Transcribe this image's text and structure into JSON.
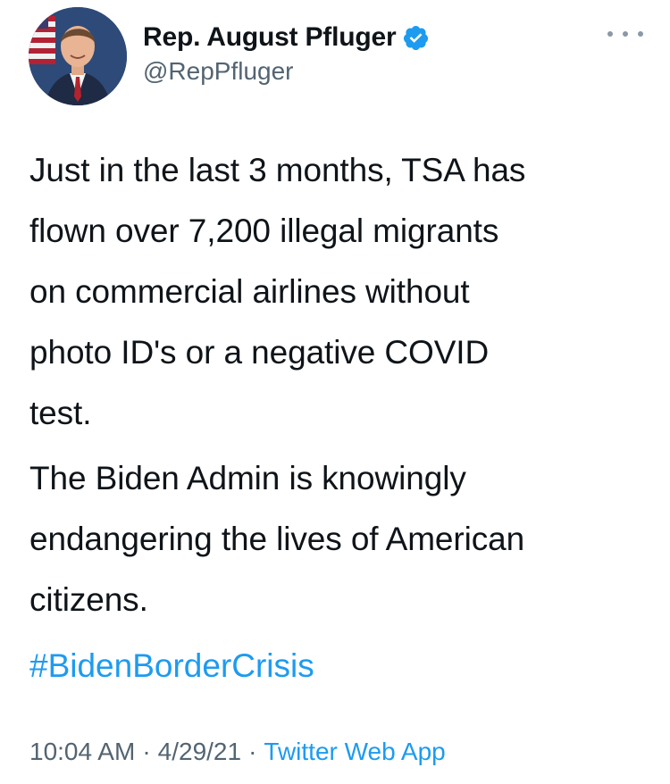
{
  "author": {
    "display_name": "Rep. August Pfluger",
    "handle": "@RepPfluger",
    "verified_icon": "verified-badge-icon",
    "avatar_icon": "profile-photo"
  },
  "tweet": {
    "paragraphs": [
      "Just in the last 3 months, TSA has\nflown over 7,200 illegal migrants\non commercial airlines without\nphoto ID's or a negative COVID\ntest.",
      "The Biden Admin is knowingly\nendangering the lives of American\ncitizens."
    ],
    "hashtag": "#BidenBorderCrisis"
  },
  "meta": {
    "time": "10:04 AM",
    "separator": "·",
    "date": "4/29/21",
    "source": "Twitter Web App"
  },
  "colors": {
    "link": "#1d9bf0",
    "secondary_text": "#536471",
    "primary_text": "#0f1419"
  },
  "more_menu_icon": "more-horizontal-icon"
}
